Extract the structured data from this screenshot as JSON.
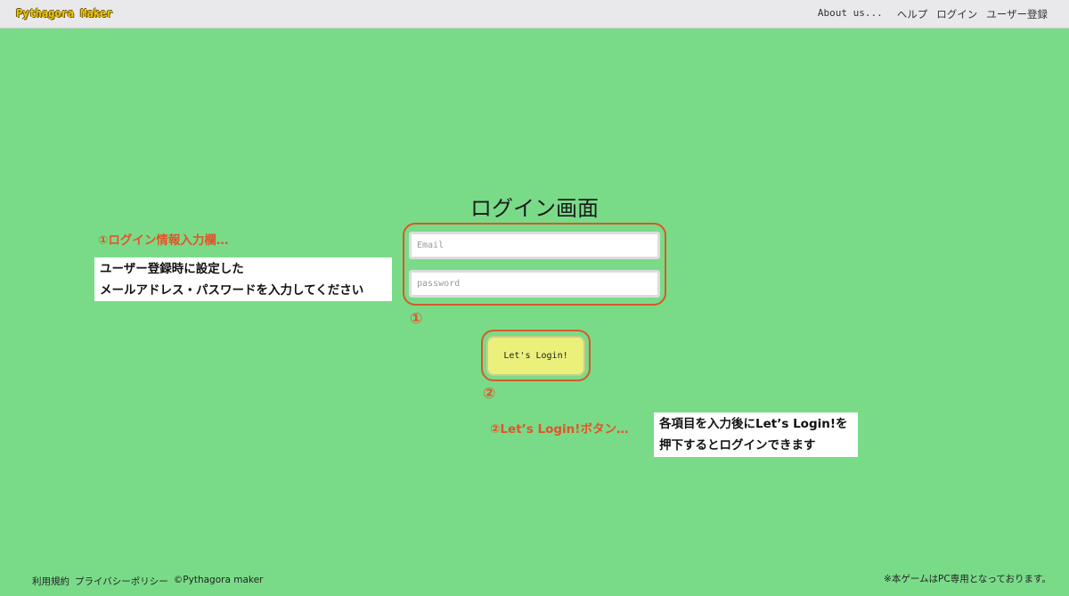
{
  "navbar": {
    "brand": "Pythagora Maker",
    "links": [
      "About us...",
      "ヘルプ",
      "ログイン",
      "ユーザー登録"
    ]
  },
  "main": {
    "title": "ログイン画面",
    "email_placeholder": "Email",
    "password_placeholder": "password",
    "login_button": "Let's Login!",
    "marker_1": "①",
    "marker_2": "②"
  },
  "annotations": {
    "first": {
      "title": "①ログイン情報入力欄…",
      "lines": [
        "ユーザー登録時に設定した",
        "メールアドレス・パスワードを入力してください"
      ]
    },
    "second": {
      "title": "②Let’s Login!ボタン…",
      "lines": [
        "各項目を入力後にLet’s Login!を",
        "押下するとログインできます"
      ]
    }
  },
  "footer": {
    "terms": "利用規約",
    "privacy": "プライバシーポリシー",
    "copyright": "©Pythagora maker",
    "notice": "※本ゲームはPC専用となっております。"
  },
  "colors": {
    "background": "#79db88",
    "navbar": "#e9e9ec",
    "highlight": "#d9582b",
    "button": "#eaf07a"
  }
}
